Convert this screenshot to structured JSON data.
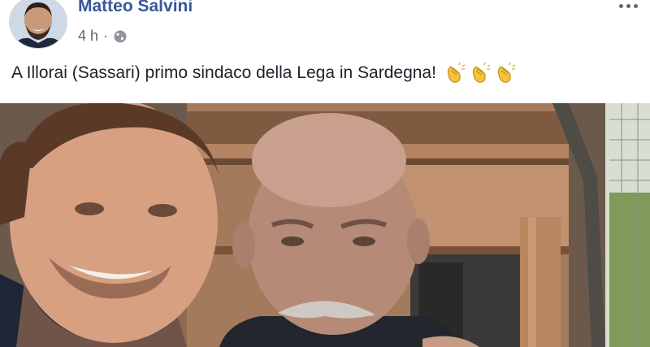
{
  "post": {
    "author": "Matteo Salvini",
    "timestamp": "4 h",
    "separator": "·",
    "audience_icon": "globe-icon",
    "text": "A Illorai (Sassari) primo sindaco della Lega in Sardegna!",
    "reactions_emoji": [
      "clapping-hands-icon",
      "clapping-hands-icon",
      "clapping-hands-icon"
    ],
    "more_icon": "more-options-icon"
  },
  "colors": {
    "author_link": "#385898",
    "meta_text": "#616770",
    "body_text": "#1d2129"
  }
}
